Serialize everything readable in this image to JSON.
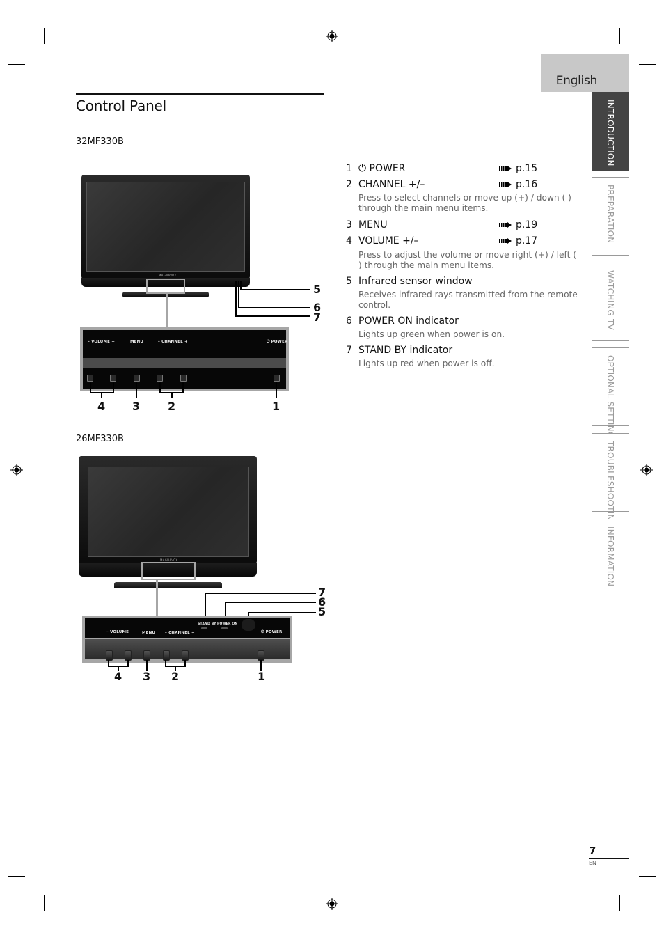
{
  "header": {
    "language": "English",
    "page_title": "Control Panel"
  },
  "side_tabs": [
    {
      "label": "INTRODUCTION",
      "active": true
    },
    {
      "label": "PREPARATION",
      "active": false
    },
    {
      "label": "WATCHING TV",
      "active": false
    },
    {
      "label": "OPTIONAL SETTING",
      "active": false
    },
    {
      "label": "TROUBLESHOOTING",
      "active": false
    },
    {
      "label": "INFORMATION",
      "active": false
    }
  ],
  "models": {
    "first": "32MF330B",
    "second": "26MF330B"
  },
  "items": [
    {
      "num": "1",
      "label": "⏻ POWER",
      "ref": "p.15",
      "desc": ""
    },
    {
      "num": "2",
      "label": "CHANNEL +/–",
      "ref": "p.16",
      "desc": "Press to select channels or move up (+) / down (  ) through the main menu items."
    },
    {
      "num": "3",
      "label": "MENU",
      "ref": "p.19",
      "desc": ""
    },
    {
      "num": "4",
      "label": "VOLUME +/–",
      "ref": "p.17",
      "desc": "Press to adjust the volume or move right (+) / left (  ) through the main menu items."
    },
    {
      "num": "5",
      "label": "Infrared sensor window",
      "ref": "",
      "desc": "Receives infrared rays transmitted from the remote control."
    },
    {
      "num": "6",
      "label": "POWER ON indicator",
      "ref": "",
      "desc": "Lights up green when power is on."
    },
    {
      "num": "7",
      "label": "STAND BY indicator",
      "ref": "",
      "desc": "Lights up red when power is off."
    }
  ],
  "panel_labels": {
    "volume": "–  VOLUME  +",
    "menu": "MENU",
    "channel": "–  CHANNEL  +",
    "power": "⏻ POWER",
    "standby": "STAND BY",
    "power_on": "POWER ON",
    "brand": "MAGNAVOX"
  },
  "callouts": {
    "one": "1",
    "two": "2",
    "three": "3",
    "four": "4",
    "five": "5",
    "six": "6",
    "seven": "7"
  },
  "footer": {
    "page_number": "7",
    "language_code": "EN"
  }
}
